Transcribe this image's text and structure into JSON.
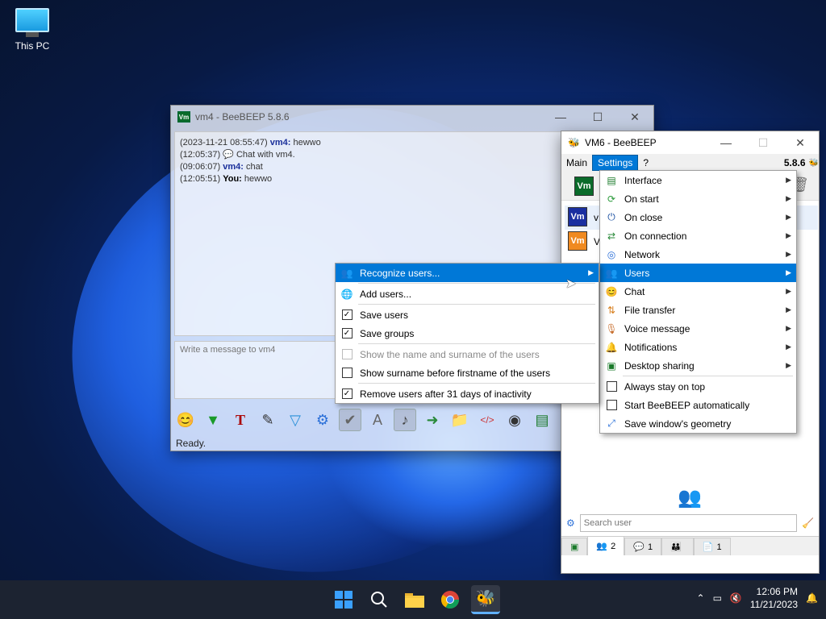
{
  "desktop": {
    "this_pc_label": "This PC"
  },
  "vm4_window": {
    "title": "vm4 - BeeBEEP 5.8.6",
    "logo_text": "Vm",
    "chat_lines": [
      {
        "time": "(2023-11-21 08:55:47)",
        "user": "vm4:",
        "text": "hewwo"
      },
      {
        "time": "(12:05:37)",
        "user": "",
        "text": "Chat with vm4."
      },
      {
        "time": "(09:06:07)",
        "user": "vm4:",
        "text": "chat"
      },
      {
        "time": "(12:05:51)",
        "user": "You:",
        "text": "hewwo"
      }
    ],
    "message_placeholder": "Write a message to vm4",
    "status": "Ready."
  },
  "vm6_window": {
    "title": "VM6 - BeeBEEP",
    "menu": {
      "main": "Main",
      "settings": "Settings",
      "help": "?",
      "version": "5.8.6"
    },
    "logo_text": "Vm",
    "users": [
      {
        "initial": "v",
        "logo": "Vm"
      },
      {
        "initial": "V",
        "logo": "Vm"
      }
    ],
    "search_placeholder": "Search user",
    "tabs": [
      {
        "icon": "users-icon",
        "count": "2"
      },
      {
        "icon": "chat-icon",
        "count": "1"
      },
      {
        "icon": "groups-icon",
        "count": ""
      },
      {
        "icon": "files-icon",
        "count": "1"
      }
    ]
  },
  "settings_menu": {
    "items": [
      {
        "label": "Interface",
        "icon": "interface-icon",
        "submenu": true
      },
      {
        "label": "On start",
        "icon": "on-start-icon",
        "submenu": true
      },
      {
        "label": "On close",
        "icon": "power-icon",
        "submenu": true
      },
      {
        "label": "On connection",
        "icon": "connection-icon",
        "submenu": true
      },
      {
        "label": "Network",
        "icon": "network-icon",
        "submenu": true
      },
      {
        "label": "Users",
        "icon": "users-icon",
        "submenu": true,
        "highlighted": true
      },
      {
        "label": "Chat",
        "icon": "chat-icon",
        "submenu": true
      },
      {
        "label": "File transfer",
        "icon": "file-transfer-icon",
        "submenu": true
      },
      {
        "label": "Voice message",
        "icon": "microphone-icon",
        "submenu": true
      },
      {
        "label": "Notifications",
        "icon": "bell-icon",
        "submenu": true
      },
      {
        "label": "Desktop sharing",
        "icon": "desktop-icon",
        "submenu": true
      },
      {
        "label": "Always stay on top",
        "checked": false
      },
      {
        "label": "Start BeeBEEP automatically",
        "checked": false
      },
      {
        "label": "Save window's geometry",
        "icon": "save-geometry-icon"
      }
    ]
  },
  "users_menu": {
    "items": [
      {
        "label": "Recognize users...",
        "highlighted": true,
        "submenu": true
      },
      {
        "label": "Add users..."
      },
      {
        "label": "Save users",
        "checked": true
      },
      {
        "label": "Save groups",
        "checked": true
      },
      {
        "label": "Show the name and surname of the users",
        "checked": false,
        "disabled": true
      },
      {
        "label": "Show surname before firstname of the users",
        "checked": false
      },
      {
        "label": "Remove users after 31 days of inactivity",
        "checked": true
      }
    ]
  },
  "taskbar": {
    "time": "12:06 PM",
    "date": "11/21/2023"
  },
  "colors": {
    "accent": "#0078d7",
    "taskbar": "#1c2331"
  }
}
